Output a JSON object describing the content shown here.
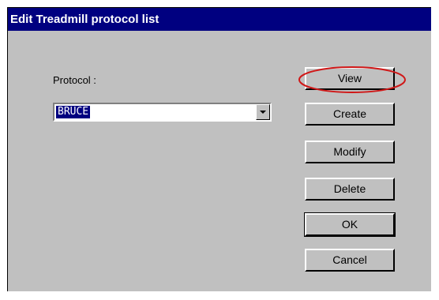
{
  "window": {
    "title": "Edit Treadmill protocol list"
  },
  "form": {
    "protocol_label": "Protocol :",
    "protocol_value": "BRUCE"
  },
  "buttons": {
    "view": "View",
    "create": "Create",
    "modify": "Modify",
    "delete": "Delete",
    "ok": "OK",
    "cancel": "Cancel"
  },
  "colors": {
    "titlebar": "#000080",
    "dialog_bg": "#c0c0c0",
    "annotation": "#d01818"
  },
  "icons": {
    "combo_arrow": "chevron-down-icon"
  }
}
